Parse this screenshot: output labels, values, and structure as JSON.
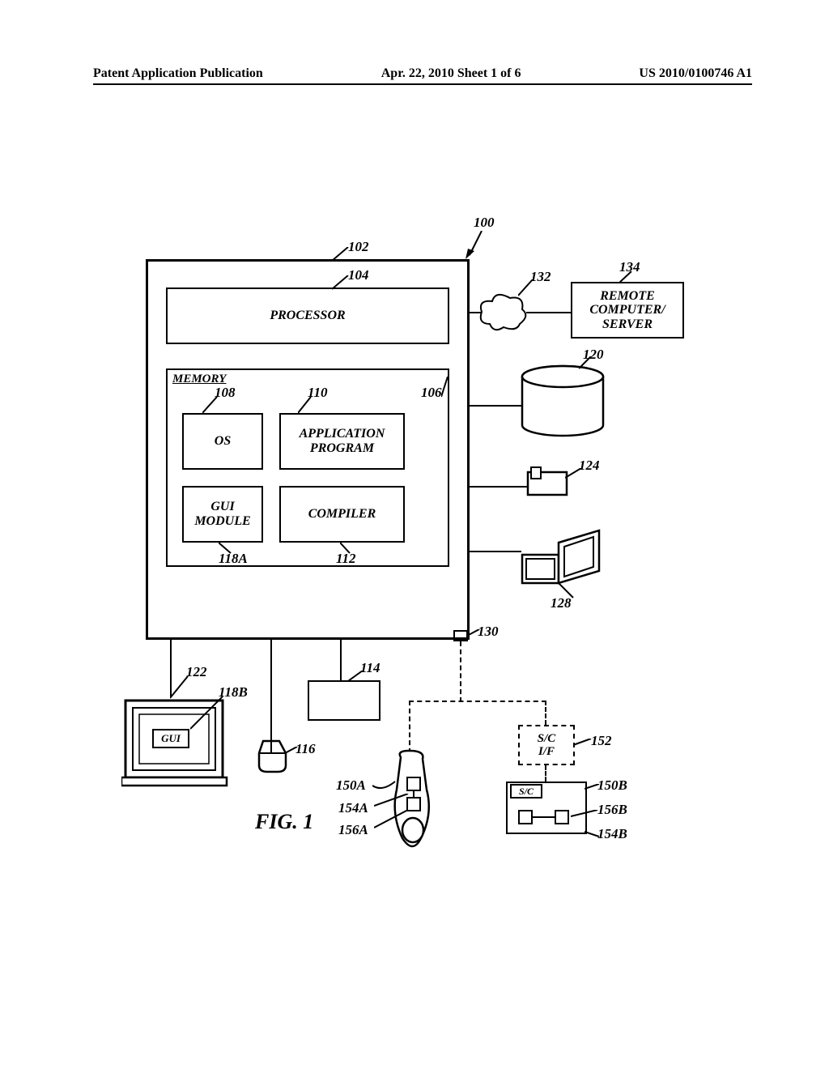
{
  "header": {
    "left": "Patent Application Publication",
    "center": "Apr. 22, 2010  Sheet 1 of 6",
    "right": "US 2010/0100746 A1"
  },
  "ref": {
    "r100": "100",
    "r102": "102",
    "r104": "104",
    "r106": "106",
    "r108": "108",
    "r110": "110",
    "r112": "112",
    "r114": "114",
    "r116": "116",
    "r118A": "118A",
    "r118B": "118B",
    "r120": "120",
    "r122": "122",
    "r124": "124",
    "r128": "128",
    "r130": "130",
    "r132": "132",
    "r134": "134",
    "r150A": "150A",
    "r150B": "150B",
    "r152": "152",
    "r154A": "154A",
    "r154B": "154B",
    "r156A": "156A",
    "r156B": "156B"
  },
  "blocks": {
    "processor": "PROCESSOR",
    "memory": "MEMORY",
    "os": "OS",
    "app": "APPLICATION\nPROGRAM",
    "gui_module": "GUI\nMODULE",
    "compiler": "COMPILER",
    "gui": "GUI",
    "remote": "REMOTE\nCOMPUTER/\nSERVER",
    "sc_if": "S/C\nI/F",
    "sc": "S/C"
  },
  "figure_caption": "FIG. 1"
}
